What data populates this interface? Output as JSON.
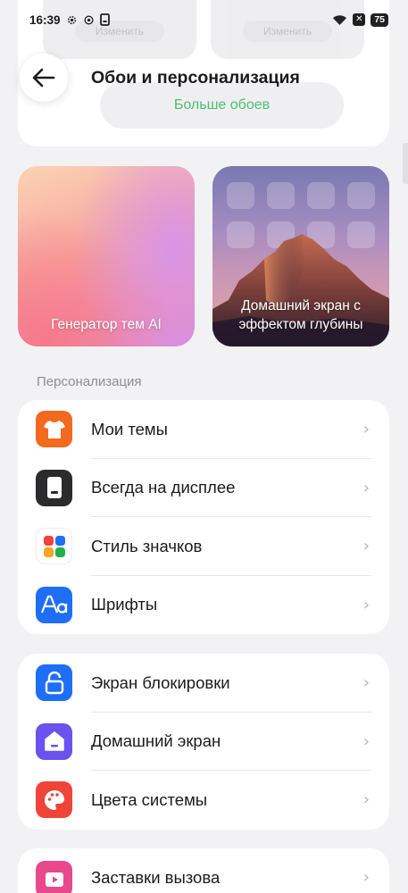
{
  "status_bar": {
    "time": "16:39",
    "battery": "75"
  },
  "top_card": {
    "ghost_button_left": "Изменить",
    "ghost_button_right": "Изменить",
    "more_wallpapers": "Больше обоев"
  },
  "header": {
    "title": "Обои и персонализация"
  },
  "tiles": {
    "ai_theme": "Генератор тем AI",
    "depth_home": "Домашний экран с эффектом глубины"
  },
  "personalization": {
    "section_title": "Персонализация",
    "items": [
      {
        "label": "Мои темы",
        "icon": "tshirt-icon",
        "color": "#f26a1f"
      },
      {
        "label": "Всегда на дисплее",
        "icon": "aod-phone-icon",
        "color": "#2b2b2d"
      },
      {
        "label": "Стиль значков",
        "icon": "icon-grid-icon",
        "color": "#ffffff"
      },
      {
        "label": "Шрифты",
        "icon": "font-icon",
        "color": "#1e6ff5"
      }
    ]
  },
  "system": {
    "items": [
      {
        "label": "Экран блокировки",
        "icon": "unlock-icon",
        "color": "#1e6ff5"
      },
      {
        "label": "Домашний экран",
        "icon": "home-icon",
        "color": "#6a52ee"
      },
      {
        "label": "Цвета системы",
        "icon": "palette-icon",
        "color": "#f04438"
      }
    ]
  },
  "call": {
    "items": [
      {
        "label": "Заставки вызова",
        "icon": "video-play-icon",
        "color": "#e8488c"
      }
    ]
  }
}
